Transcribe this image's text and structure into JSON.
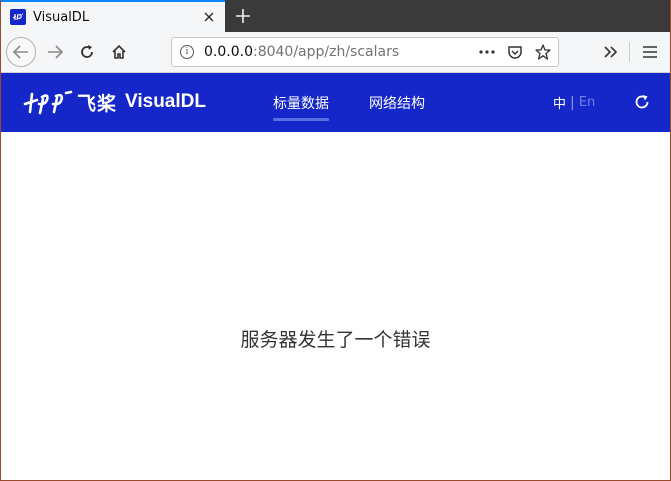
{
  "browser": {
    "tab": {
      "title": "VisualDL",
      "favicon": "paddle-favicon",
      "close_icon": "close-icon"
    },
    "new_tab_icon": "plus-icon",
    "nav": {
      "back_icon": "arrow-left-icon",
      "forward_icon": "arrow-right-icon",
      "reload_icon": "reload-icon",
      "home_icon": "home-icon"
    },
    "url": {
      "host": "0.0.0.0",
      "rest": ":8040/app/zh/scalars",
      "info_icon": "info-icon",
      "more_icon": "ellipsis-icon",
      "pocket_icon": "pocket-icon",
      "bookmark_icon": "star-icon"
    },
    "overflow_icon": "chevron-double-right-icon",
    "menu_icon": "hamburger-menu-icon"
  },
  "app": {
    "brand_cn": "飞桨",
    "brand_name": "VisualDL",
    "menu": [
      {
        "label": "标量数据",
        "active": true
      },
      {
        "label": "网络结构",
        "active": false
      }
    ],
    "lang": {
      "zh": "中",
      "separator": "|",
      "en": "En"
    },
    "refresh_icon": "refresh-icon",
    "colors": {
      "header_bg": "#1527c9",
      "active_underline": "#5a6fe6"
    }
  },
  "main": {
    "error_message": "服务器发生了一个错误"
  }
}
